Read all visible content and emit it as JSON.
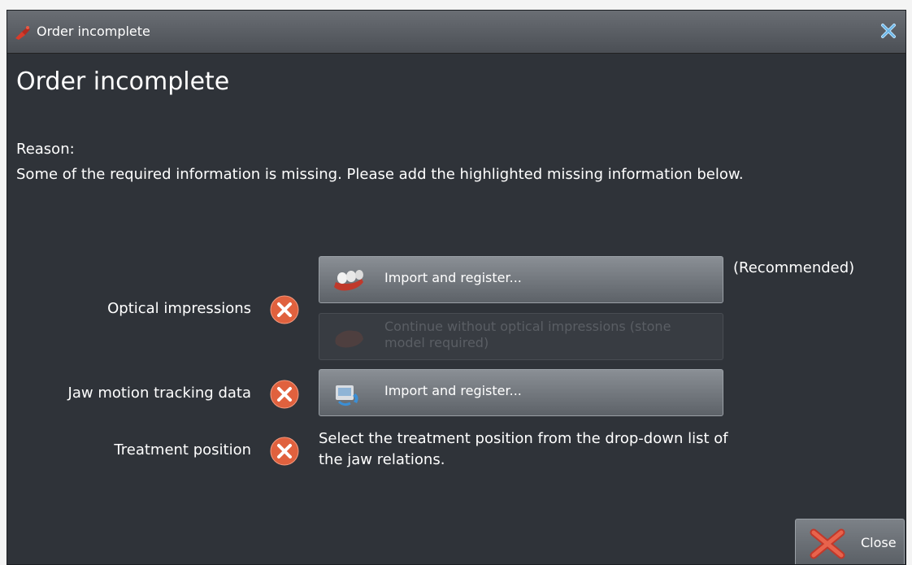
{
  "window": {
    "title": "Order incomplete",
    "heading": "Order incomplete"
  },
  "reason": {
    "label": "Reason:",
    "text": "Some of the required information is missing. Please add the highlighted missing information below."
  },
  "rows": {
    "optical": {
      "label": "Optical impressions",
      "import_label": "Import and register...",
      "recommended": "(Recommended)",
      "continue_label": "Continue without optical impressions (stone model required)"
    },
    "jaw": {
      "label": "Jaw motion tracking data",
      "import_label": "Import and register..."
    },
    "treatment": {
      "label": "Treatment position",
      "info": "Select the treatment position from the drop-down list of the jaw relations."
    }
  },
  "footer": {
    "close_label": "Close"
  },
  "colors": {
    "window_bg": "#2f3339",
    "error_badge": "#e0613e"
  },
  "icons": [
    "order-icon",
    "window-close-icon",
    "error-icon",
    "teeth-model-icon",
    "jaw-motion-icon",
    "close-x-icon"
  ]
}
